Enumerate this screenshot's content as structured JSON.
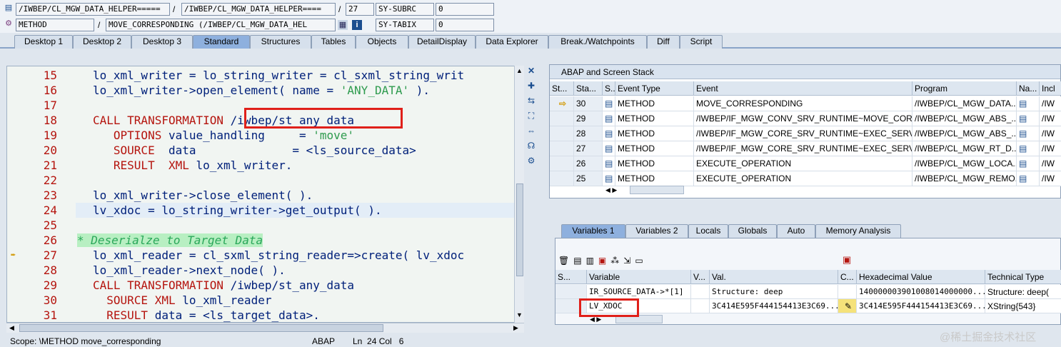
{
  "top": {
    "program_field": "/IWBEP/CL_MGW_DATA_HELPER=====",
    "include_field": "/IWBEP/CL_MGW_DATA_HELPER====",
    "line_field": "27",
    "sy_subrc_label": "SY-SUBRC",
    "sy_subrc_value": "0",
    "event_type_field": "METHOD",
    "event_field": "MOVE_CORRESPONDING (/IWBEP/CL_MGW_DATA_HEL",
    "sy_tabix_label": "SY-TABIX",
    "sy_tabix_value": "0",
    "slash": "/"
  },
  "tabs": [
    "Desktop 1",
    "Desktop 2",
    "Desktop 3",
    "Standard",
    "Structures",
    "Tables",
    "Objects",
    "DetailDisplay",
    "Data Explorer",
    "Break./Watchpoints",
    "Diff",
    "Script"
  ],
  "active_tab": "Standard",
  "code": [
    {
      "n": "15",
      "parts": [
        {
          "t": "lo_xml_writer = lo_string_writer = cl_sxml_string_writ",
          "c": ""
        }
      ]
    },
    {
      "n": "16",
      "parts": [
        {
          "t": "lo_xml_writer->open_element( name = ",
          "c": ""
        },
        {
          "t": "'ANY_DATA'",
          "c": "str"
        },
        {
          "t": " ).",
          "c": ""
        }
      ]
    },
    {
      "n": "17",
      "parts": []
    },
    {
      "n": "18",
      "parts": [
        {
          "t": "CALL TRANSFORMATION ",
          "c": "kw"
        },
        {
          "t": "/iwbep/st_any_data",
          "c": ""
        }
      ]
    },
    {
      "n": "19",
      "parts": [
        {
          "t": "   OPTIONS ",
          "c": "kw"
        },
        {
          "t": "value_handling     = ",
          "c": ""
        },
        {
          "t": "'move'",
          "c": "str"
        }
      ]
    },
    {
      "n": "20",
      "parts": [
        {
          "t": "   SOURCE ",
          "c": "kw"
        },
        {
          "t": " data              = <ls_source_data>",
          "c": ""
        }
      ]
    },
    {
      "n": "21",
      "parts": [
        {
          "t": "   RESULT  XML ",
          "c": "kw"
        },
        {
          "t": "lo_xml_writer.",
          "c": ""
        }
      ]
    },
    {
      "n": "22",
      "parts": []
    },
    {
      "n": "23",
      "parts": [
        {
          "t": "lo_xml_writer->close_element( ).",
          "c": ""
        }
      ]
    },
    {
      "n": "24",
      "parts": [
        {
          "t": "lv_xdoc = lo_string_writer->get_output( ).",
          "c": ""
        }
      ],
      "current": true
    },
    {
      "n": "25",
      "parts": []
    },
    {
      "n": "26",
      "parts": [
        {
          "t": "* Deserialze to Target Data",
          "c": "cm"
        }
      ]
    },
    {
      "n": "27",
      "parts": [
        {
          "t": "lo_xml_reader = cl_sxml_string_reader=>create( lv_xdoc",
          "c": ""
        }
      ],
      "arrow": true
    },
    {
      "n": "28",
      "parts": [
        {
          "t": "lo_xml_reader->next_node( ).",
          "c": ""
        }
      ]
    },
    {
      "n": "29",
      "parts": [
        {
          "t": "CALL TRANSFORMATION ",
          "c": "kw"
        },
        {
          "t": "/iwbep/st_any_data",
          "c": ""
        }
      ]
    },
    {
      "n": "30",
      "parts": [
        {
          "t": "  SOURCE XML ",
          "c": "kw"
        },
        {
          "t": "lo_xml_reader",
          "c": ""
        }
      ]
    },
    {
      "n": "31",
      "parts": [
        {
          "t": "  RESULT ",
          "c": "kw"
        },
        {
          "t": "data = <ls_target_data>.",
          "c": ""
        }
      ]
    }
  ],
  "status": {
    "scope": "Scope: \\METHOD move_corresponding",
    "lang": "ABAP",
    "pos": "Ln  24 Col   6"
  },
  "stack": {
    "title": "ABAP and Screen Stack",
    "headers": [
      "St...",
      "Sta...",
      "S...",
      "Event Type",
      "Event",
      "Program",
      "Na...",
      "Incl"
    ],
    "rows": [
      {
        "level": "30",
        "type": "METHOD",
        "event": "MOVE_CORRESPONDING",
        "program": "/IWBEP/CL_MGW_DATA...",
        "incl": "/IW",
        "current": true
      },
      {
        "level": "29",
        "type": "METHOD",
        "event": "/IWBEP/IF_MGW_CONV_SRV_RUNTIME~MOVE_CORR...",
        "program": "/IWBEP/CL_MGW_ABS_...",
        "incl": "/IW"
      },
      {
        "level": "28",
        "type": "METHOD",
        "event": "/IWBEP/IF_MGW_CORE_SRV_RUNTIME~EXEC_SERVI...",
        "program": "/IWBEP/CL_MGW_ABS_...",
        "incl": "/IW"
      },
      {
        "level": "27",
        "type": "METHOD",
        "event": "/IWBEP/IF_MGW_CORE_SRV_RUNTIME~EXEC_SERVI...",
        "program": "/IWBEP/CL_MGW_RT_D...",
        "incl": "/IW"
      },
      {
        "level": "26",
        "type": "METHOD",
        "event": "EXECUTE_OPERATION",
        "program": "/IWBEP/CL_MGW_LOCA...",
        "incl": "/IW"
      },
      {
        "level": "25",
        "type": "METHOD",
        "event": "EXECUTE_OPERATION",
        "program": "/IWBEP/CL_MGW_REMO...",
        "incl": "/IW"
      }
    ]
  },
  "var_tabs": [
    "Variables 1",
    "Variables 2",
    "Locals",
    "Globals",
    "Auto",
    "Memory Analysis"
  ],
  "vars": {
    "headers": [
      "S...",
      "Variable",
      "V...",
      "Val.",
      "C...",
      "Hexadecimal Value",
      "Technical Type"
    ],
    "rows": [
      {
        "name": "IR_SOURCE_DATA->*[1]",
        "value": "Structure: deep",
        "hex": "140000003901008014000000...",
        "type": "Structure: deep("
      },
      {
        "name": "LV_XDOC",
        "value": "3C414E595F444154413E3C69...",
        "hex": "3C414E595F444154413E3C69...",
        "type": "XString{543}"
      }
    ]
  },
  "watermark": "@稀土掘金技术社区"
}
